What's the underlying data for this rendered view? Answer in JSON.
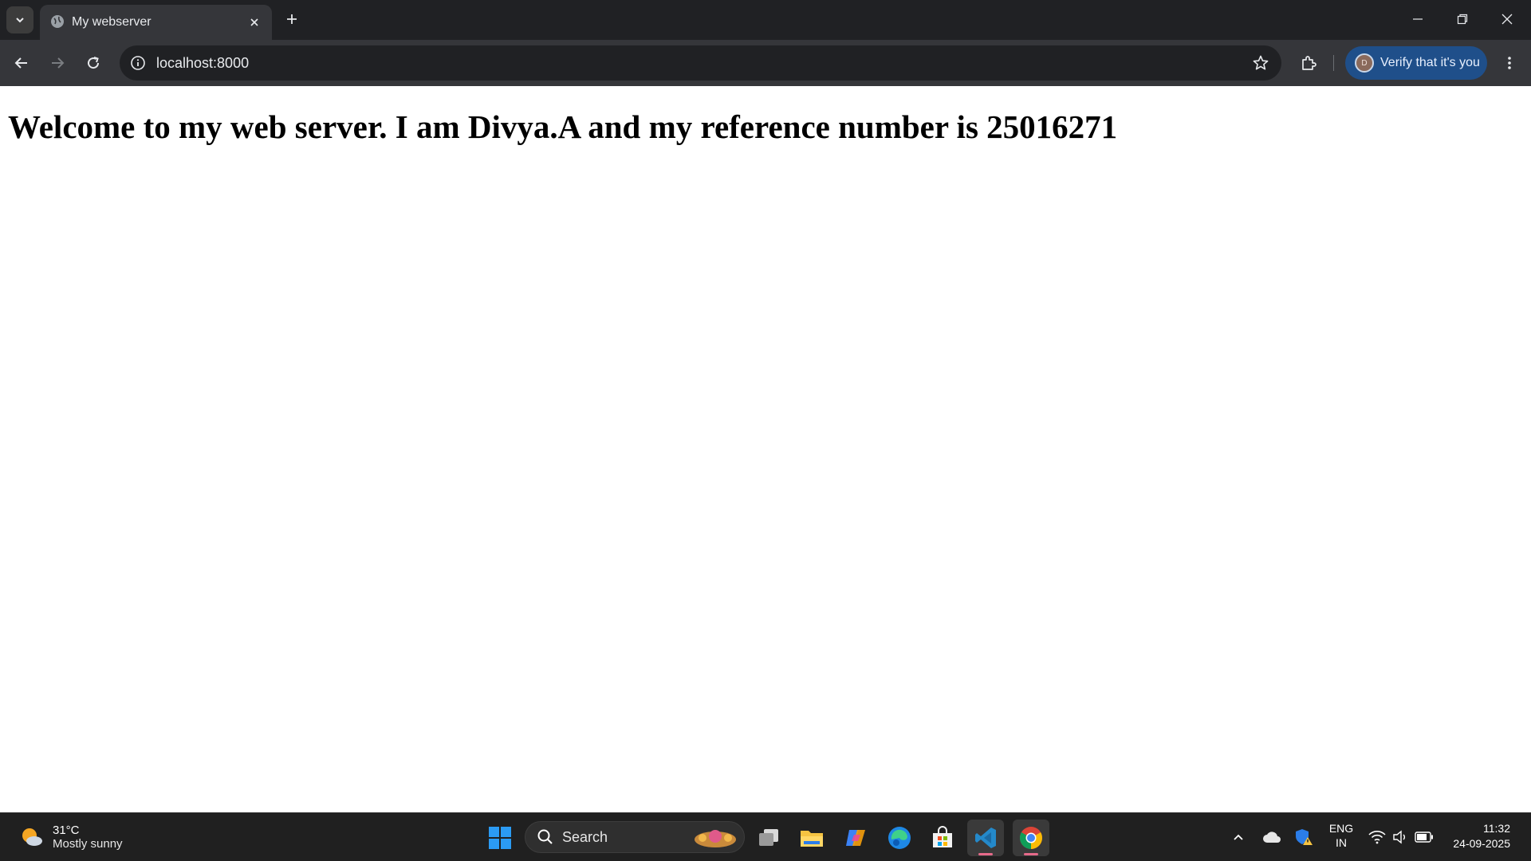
{
  "browser": {
    "tab": {
      "title": "My webserver"
    },
    "address_bar": {
      "url": "localhost:8000"
    },
    "profile_button": {
      "label": "Verify that it's you",
      "avatar_letter": "D"
    }
  },
  "page": {
    "heading": "Welcome to my web server. I am Divya.A and my reference number is 25016271"
  },
  "taskbar": {
    "weather": {
      "temperature": "31°C",
      "condition": "Mostly sunny"
    },
    "search": {
      "label": "Search"
    },
    "apps": [
      "start-icon",
      "search",
      "task-view-icon",
      "file-explorer-icon",
      "copilot-icon",
      "edge-icon",
      "store-icon",
      "vscode-icon",
      "chrome-icon"
    ],
    "language": {
      "line1": "ENG",
      "line2": "IN"
    },
    "clock": {
      "time": "11:32",
      "date": "24-09-2025"
    }
  },
  "colors": {
    "tabstrip_bg": "#202124",
    "toolbar_bg": "#35363a",
    "omnibox_bg": "#202124",
    "verify_bg": "#1f4f8a",
    "taskbar_bg": "#202020",
    "active_indicator": "#e66a8a"
  }
}
